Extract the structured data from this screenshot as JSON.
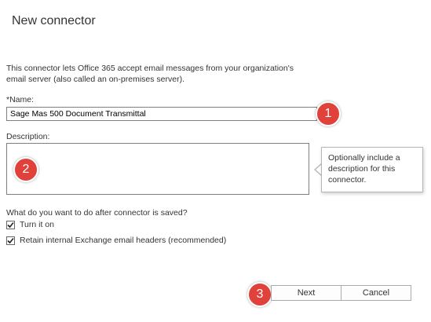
{
  "dialog": {
    "title": "New connector",
    "intro": "This connector lets Office 365 accept email messages from your organization's email server (also called an on-premises server)."
  },
  "name_field": {
    "label": "*Name:",
    "value": "Sage Mas 500 Document Transmittal"
  },
  "description_field": {
    "label": "Description:",
    "value": "",
    "tooltip": "Optionally include a description for this connector."
  },
  "after_save": {
    "question": "What do you want to do after connector is saved?",
    "options": [
      {
        "label": "Turn it on",
        "checked": true
      },
      {
        "label": "Retain internal Exchange email headers (recommended)",
        "checked": true
      }
    ]
  },
  "buttons": {
    "next": "Next",
    "cancel": "Cancel"
  },
  "markers": [
    "1",
    "2",
    "3"
  ],
  "colors": {
    "marker": "#e0413a",
    "border": "#7f7f7f"
  }
}
